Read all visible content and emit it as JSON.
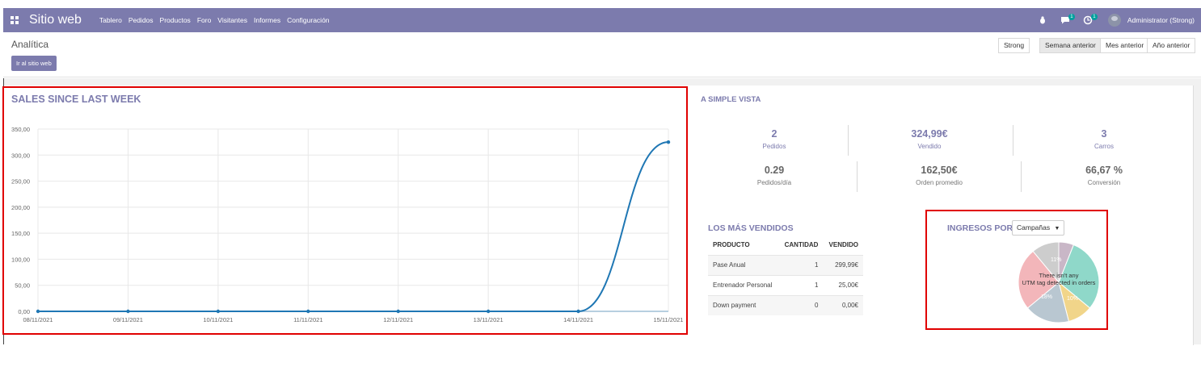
{
  "topbar": {
    "app_title": "Sitio web",
    "menu": [
      "Tablero",
      "Pedidos",
      "Productos",
      "Foro",
      "Visitantes",
      "Informes",
      "Configuración"
    ],
    "user": "Administrator (Strong)",
    "badges": [
      "1",
      "1"
    ],
    "icons": [
      "apps-icon",
      "bug-icon",
      "chat-icon",
      "activity-icon",
      "avatar"
    ]
  },
  "control": {
    "title": "Analítica",
    "goto_site": "Ir al sitio web",
    "website_filter": "Strong",
    "periods": [
      "Semana anterior",
      "Mes anterior",
      "Año anterior"
    ],
    "active_period": "Semana anterior"
  },
  "sales": {
    "title": "SALES SINCE LAST WEEK"
  },
  "chart_data": {
    "type": "line",
    "title": "SALES SINCE LAST WEEK",
    "x": [
      "08/11/2021",
      "09/11/2021",
      "10/11/2021",
      "11/11/2021",
      "12/11/2021",
      "13/11/2021",
      "14/11/2021",
      "15/11/2021"
    ],
    "series": [
      {
        "values": [
          0,
          0,
          0,
          0,
          0,
          0,
          0,
          324.99
        ]
      }
    ],
    "y_ticks": [
      "0,00",
      "50,00",
      "100,00",
      "150,00",
      "200,00",
      "250,00",
      "300,00",
      "350,00"
    ],
    "ylim": [
      0,
      350
    ],
    "grid": true,
    "color": "#1f77b4"
  },
  "glance": {
    "title": "A SIMPLE VISTA",
    "row1": [
      {
        "value": "2",
        "label": "Pedidos"
      },
      {
        "value": "324,99€",
        "label": "Vendido"
      },
      {
        "value": "3",
        "label": "Carros"
      }
    ],
    "row2": [
      {
        "value": "0.29",
        "label": "Pedidos/día"
      },
      {
        "value": "162,50€",
        "label": "Orden promedio"
      },
      {
        "value": "66,67 %",
        "label": "Conversión"
      }
    ]
  },
  "best_sellers": {
    "title": "LOS MÁS VENDIDOS",
    "columns": [
      "PRODUCTO",
      "CANTIDAD",
      "VENDIDO"
    ],
    "rows": [
      [
        "Pase Anual",
        "1",
        "299,99€"
      ],
      [
        "Entrenador Personal",
        "1",
        "25,00€"
      ],
      [
        "Down payment",
        "0",
        "0,00€"
      ]
    ]
  },
  "revenue": {
    "title": "INGRESOS POR",
    "selector": "Campañas",
    "empty_message_line1": "There isn't any",
    "empty_message_line2": "UTM tag detected in orders",
    "pie_labels": [
      "11%",
      "18%",
      "10%"
    ],
    "pie_colors": [
      "#c9b7c7",
      "#8fd8c9",
      "#f1d58a",
      "#b9c7d1",
      "#f3b6ba",
      "#cdcdcd"
    ]
  },
  "highlight_color": "#e00000"
}
